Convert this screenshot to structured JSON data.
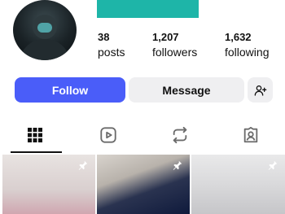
{
  "profile": {
    "stats": [
      {
        "count": "38",
        "label": "posts"
      },
      {
        "count": "1,207",
        "label": "followers"
      },
      {
        "count": "1,632",
        "label": "following"
      }
    ]
  },
  "actions": {
    "follow_label": "Follow",
    "message_label": "Message",
    "add_person_icon": "add-person-icon"
  },
  "tabs": [
    {
      "icon": "grid-icon",
      "selected": true
    },
    {
      "icon": "reels-icon",
      "selected": false
    },
    {
      "icon": "reposts-icon",
      "selected": false
    },
    {
      "icon": "tagged-icon",
      "selected": false
    }
  ],
  "posts": [
    {
      "pinned": true
    },
    {
      "pinned": true
    },
    {
      "pinned": true
    }
  ],
  "colors": {
    "accent": "#4a5df9",
    "name_bar": "#1eb5a8",
    "secondary_button": "#efeff1"
  }
}
